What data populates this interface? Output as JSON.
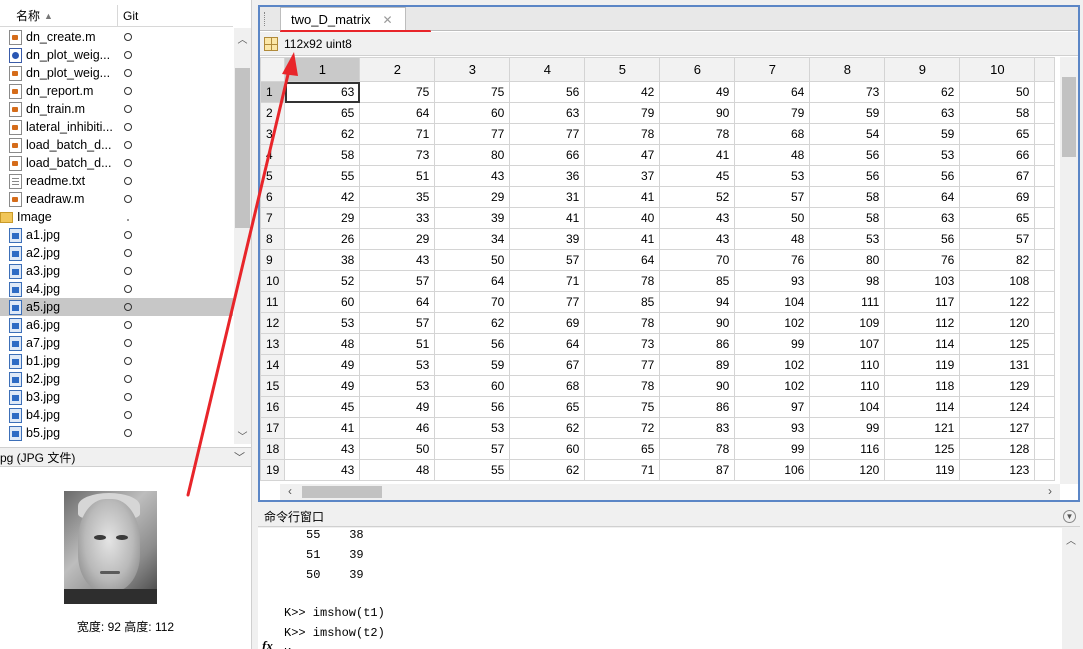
{
  "file_browser": {
    "col_name": "名称",
    "col_git": "Git",
    "files": [
      {
        "name": "dn_create.m",
        "type": "m",
        "git": "circle"
      },
      {
        "name": "dn_plot_weig...",
        "type": "fig",
        "git": "circle"
      },
      {
        "name": "dn_plot_weig...",
        "type": "m",
        "git": "circle"
      },
      {
        "name": "dn_report.m",
        "type": "m",
        "git": "circle"
      },
      {
        "name": "dn_train.m",
        "type": "m",
        "git": "circle"
      },
      {
        "name": "lateral_inhibiti...",
        "type": "m",
        "git": "circle"
      },
      {
        "name": "load_batch_d...",
        "type": "m",
        "git": "circle"
      },
      {
        "name": "load_batch_d...",
        "type": "m",
        "git": "circle"
      },
      {
        "name": "readme.txt",
        "type": "txt",
        "git": "circle"
      },
      {
        "name": "readraw.m",
        "type": "m",
        "git": "circle"
      },
      {
        "name": "Image",
        "type": "folder",
        "git": "dot"
      },
      {
        "name": "a1.jpg",
        "type": "jpg",
        "git": "circle"
      },
      {
        "name": "a2.jpg",
        "type": "jpg",
        "git": "circle"
      },
      {
        "name": "a3.jpg",
        "type": "jpg",
        "git": "circle"
      },
      {
        "name": "a4.jpg",
        "type": "jpg",
        "git": "circle"
      },
      {
        "name": "a5.jpg",
        "type": "jpg",
        "git": "circle",
        "selected": true
      },
      {
        "name": "a6.jpg",
        "type": "jpg",
        "git": "circle"
      },
      {
        "name": "a7.jpg",
        "type": "jpg",
        "git": "circle"
      },
      {
        "name": "b1.jpg",
        "type": "jpg",
        "git": "circle"
      },
      {
        "name": "b2.jpg",
        "type": "jpg",
        "git": "circle"
      },
      {
        "name": "b3.jpg",
        "type": "jpg",
        "git": "circle"
      },
      {
        "name": "b4.jpg",
        "type": "jpg",
        "git": "circle"
      },
      {
        "name": "b5.jpg",
        "type": "jpg",
        "git": "circle"
      }
    ]
  },
  "details": {
    "label": "pg  (JPG 文件)",
    "caption": "宽度: 92 高度: 112"
  },
  "editor": {
    "tab_title": "two_D_matrix",
    "var_info": "112x92 uint8",
    "columns": [
      "1",
      "2",
      "3",
      "4",
      "5",
      "6",
      "7",
      "8",
      "9",
      "10"
    ],
    "rows": [
      [
        63,
        75,
        75,
        56,
        42,
        49,
        64,
        73,
        62,
        50
      ],
      [
        65,
        64,
        60,
        63,
        79,
        90,
        79,
        59,
        63,
        58
      ],
      [
        62,
        71,
        77,
        77,
        78,
        78,
        68,
        54,
        59,
        65
      ],
      [
        58,
        73,
        80,
        66,
        47,
        41,
        48,
        56,
        53,
        66
      ],
      [
        55,
        51,
        43,
        36,
        37,
        45,
        53,
        56,
        56,
        67
      ],
      [
        42,
        35,
        29,
        31,
        41,
        52,
        57,
        58,
        64,
        69
      ],
      [
        29,
        33,
        39,
        41,
        40,
        43,
        50,
        58,
        63,
        65
      ],
      [
        26,
        29,
        34,
        39,
        41,
        43,
        48,
        53,
        56,
        57
      ],
      [
        38,
        43,
        50,
        57,
        64,
        70,
        76,
        80,
        76,
        82
      ],
      [
        52,
        57,
        64,
        71,
        78,
        85,
        93,
        98,
        103,
        108
      ],
      [
        60,
        64,
        70,
        77,
        85,
        94,
        104,
        111,
        117,
        122
      ],
      [
        53,
        57,
        62,
        69,
        78,
        90,
        102,
        109,
        112,
        120
      ],
      [
        48,
        51,
        56,
        64,
        73,
        86,
        99,
        107,
        114,
        125
      ],
      [
        49,
        53,
        59,
        67,
        77,
        89,
        102,
        110,
        119,
        131
      ],
      [
        49,
        53,
        60,
        68,
        78,
        90,
        102,
        110,
        118,
        129
      ],
      [
        45,
        49,
        56,
        65,
        75,
        86,
        97,
        104,
        114,
        124
      ],
      [
        41,
        46,
        53,
        62,
        72,
        83,
        93,
        99,
        121,
        127
      ],
      [
        43,
        50,
        57,
        60,
        65,
        78,
        99,
        116,
        125,
        128
      ],
      [
        43,
        48,
        55,
        62,
        71,
        87,
        106,
        120,
        119,
        123
      ]
    ]
  },
  "command_window": {
    "title": "命令行窗口",
    "lines": [
      "55    38",
      "51    39",
      "50    39",
      "",
      "K>> imshow(t1)",
      "K>> imshow(t2)",
      "K>>"
    ],
    "fx": "fx"
  },
  "colors": {
    "annotation": "#e8252a",
    "selection": "#c7c7c7",
    "editor_border": "#5b86c6"
  }
}
